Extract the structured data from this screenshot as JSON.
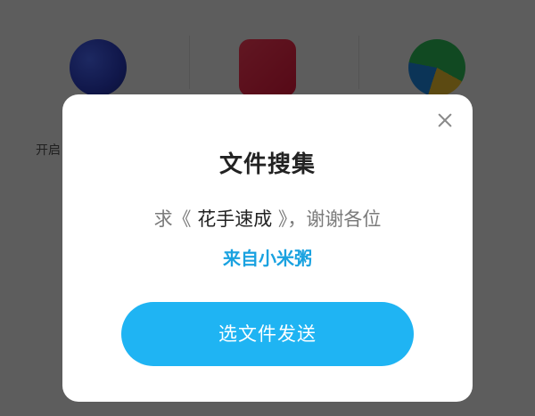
{
  "background": {
    "apps": [
      {
        "icon": "gallery-icon"
      },
      {
        "icon": "video-icon"
      },
      {
        "icon": "music-icon"
      }
    ],
    "partial_text": "开启"
  },
  "dialog": {
    "title": "文件搜集",
    "message_prefix": "求《 ",
    "message_highlight": "花手速成",
    "message_suffix": " 》，谢谢各位",
    "source": "来自小米粥",
    "send_button_label": "选文件发送",
    "close_icon": "close-icon"
  },
  "colors": {
    "accent": "#1fb4f3",
    "source_text": "#1aa2e0",
    "overlay": "rgba(0,0,0,0.62)"
  }
}
